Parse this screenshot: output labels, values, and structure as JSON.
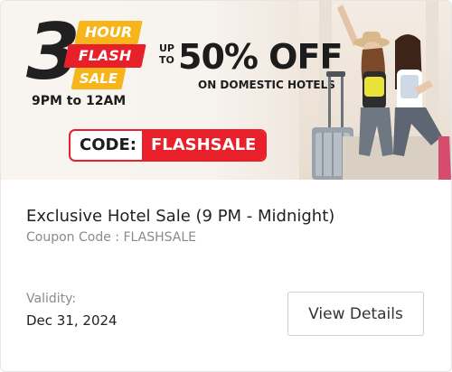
{
  "banner": {
    "big_number": "3",
    "hour_label": "HOUR",
    "flash_label": "FLASH",
    "sale_label": "SALE",
    "time_range": "9PM to 12AM",
    "upto_line1": "UP",
    "upto_line2": "TO",
    "discount": "50% OFF",
    "subtitle": "ON DOMESTIC HOTELS",
    "code_label": "CODE:",
    "code_value": "FLASHSALE",
    "colors": {
      "red": "#e8202a",
      "yellow": "#f5b51b",
      "dark": "#1c1c1c"
    }
  },
  "offer": {
    "title": "Exclusive Hotel Sale (9 PM - Midnight)",
    "coupon": "Coupon Code : FLASHSALE",
    "validity_label": "Validity:",
    "validity_value": "Dec 31, 2024",
    "button_label": "View Details"
  }
}
